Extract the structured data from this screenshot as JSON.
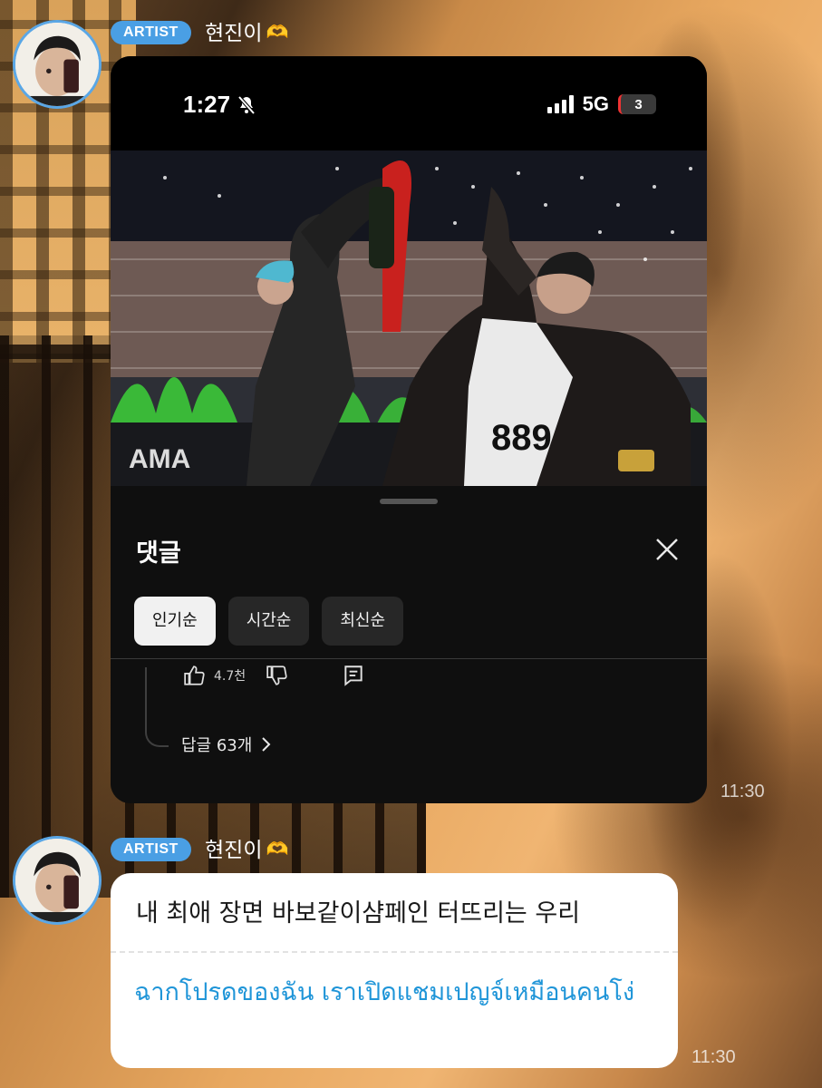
{
  "messages": [
    {
      "badge": "ARTIST",
      "sender": "현진이",
      "sender_emoji": "🫶",
      "timestamp": "11:30",
      "attachment": {
        "status_bar": {
          "time": "1:27",
          "network": "5G",
          "battery": "3"
        },
        "comments_sheet": {
          "title": "댓글",
          "sort_chips": [
            "인기순",
            "시간순",
            "최신순"
          ],
          "active_chip": "인기순",
          "like_count": "4.7천",
          "replies_label": "답글 63개"
        }
      }
    },
    {
      "badge": "ARTIST",
      "sender": "현진이",
      "sender_emoji": "🫶",
      "timestamp": "11:30",
      "text": "내 최애 장면 바보같이샴페인 터뜨리는 우리",
      "translation": "ฉากโปรดของฉัน เราเปิดแชมเปญจ์เหมือนคนโง่"
    }
  ],
  "colors": {
    "badge": "#4a9fe4",
    "translation_text": "#1f95d8",
    "avatar_ring": "#5aa7e6"
  }
}
